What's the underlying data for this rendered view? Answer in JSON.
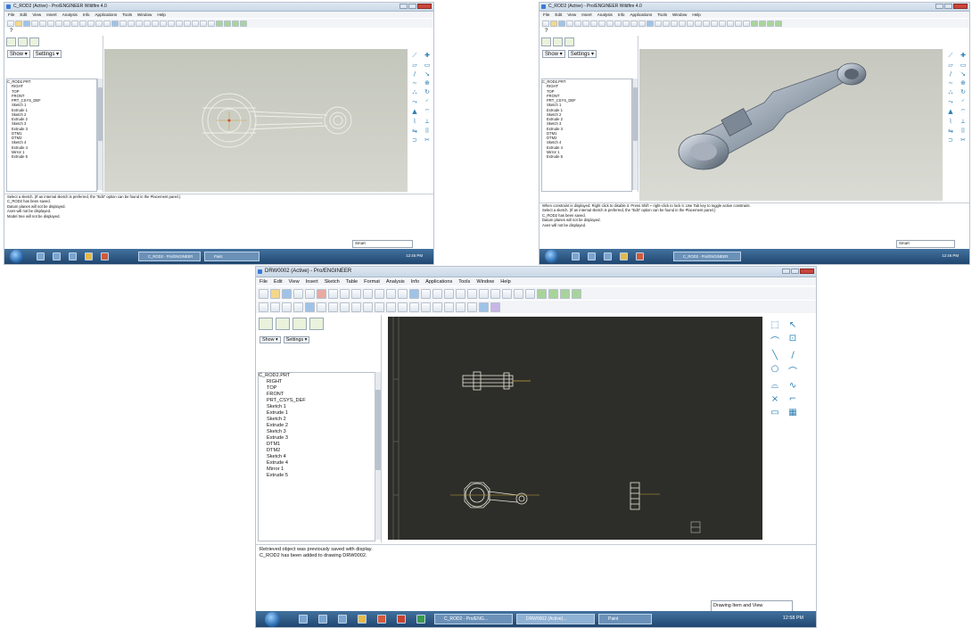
{
  "colors": {
    "viewport_gray": "#c9cbc0",
    "drawing_bg": "#2d2e2a",
    "taskbar": "#2f5a86",
    "accent_icon": "#2a7fb4"
  },
  "screen1": {
    "title": "C_ROD2 (Active) - Pro/ENGINEER Wildfire 4.0",
    "menus": [
      "File",
      "Edit",
      "View",
      "Insert",
      "Analysis",
      "Info",
      "Applications",
      "Tools",
      "Window",
      "Help"
    ],
    "help_icon": "?",
    "show_label": "Show ▾",
    "settings_label": "Settings ▾",
    "tree": [
      "C_ROD2.PRT",
      "RIGHT",
      "TOP",
      "FRONT",
      "PRT_CSYS_DEF",
      "Sketch 1",
      "Extrude 1",
      "Sketch 2",
      "Extrude 2",
      "Sketch 3",
      "Extrude 3",
      "DTM1",
      "DTM2",
      "Sketch 4",
      "Extrude 4",
      "Mirror 1",
      "Extrude 5"
    ],
    "messages": [
      "Select a sketch. (If an internal sketch is preferred, the “Edit” option can be found in the Placement panel.)",
      "C_ROD2 has been saved.",
      "Datum planes will not be displayed.",
      "Axes will not be displayed.",
      "Model tree will not be displayed."
    ],
    "filter": "Smart",
    "taskbar_apps": [
      "C_ROD2 - Pro/ENGINEER",
      "Paint"
    ],
    "clock": "12:45 PM"
  },
  "screen2": {
    "title": "C_ROD2 (Active) - Pro/ENGINEER Wildfire 4.0",
    "menus": [
      "File",
      "Edit",
      "View",
      "Insert",
      "Analysis",
      "Info",
      "Applications",
      "Tools",
      "Window",
      "Help"
    ],
    "help_icon": "?",
    "show_label": "Show ▾",
    "settings_label": "Settings ▾",
    "tree": [
      "C_ROD2.PRT",
      "RIGHT",
      "TOP",
      "FRONT",
      "PRT_CSYS_DEF",
      "Sketch 1",
      "Extrude 1",
      "Sketch 2",
      "Extrude 2",
      "Sketch 3",
      "Extrude 3",
      "DTM1",
      "DTM2",
      "Sketch 4",
      "Extrude 4",
      "Mirror 1",
      "Extrude 5"
    ],
    "messages": [
      "When constraint is displayed: Right click to disable it. Press Shift + right-click to lock it. Use Tab key to toggle active constraint.",
      "Select a sketch. (If an internal sketch is preferred, the “Edit” option can be found in the Placement panel.)",
      "C_ROD2 has been saved.",
      "Datum planes will not be displayed.",
      "Axes will not be displayed."
    ],
    "filter": "Smart",
    "taskbar_apps": [
      "C_ROD2 - Pro/ENGINEER"
    ],
    "clock": "12:46 PM"
  },
  "screen3": {
    "title": "DRW0002 (Active) - Pro/ENGINEER",
    "menus": [
      "File",
      "Edit",
      "View",
      "Insert",
      "Sketch",
      "Table",
      "Format",
      "Analysis",
      "Info",
      "Applications",
      "Tools",
      "Window",
      "Help"
    ],
    "show_label": "Show ▾",
    "settings_label": "Settings ▾",
    "tree": [
      "C_ROD2.PRT",
      "RIGHT",
      "TOP",
      "FRONT",
      "PRT_CSYS_DEF",
      "Sketch 1",
      "Extrude 1",
      "Sketch 2",
      "Extrude 2",
      "Sketch 3",
      "Extrude 3",
      "DTM1",
      "DTM2",
      "Sketch 4",
      "Extrude 4",
      "Mirror 1",
      "Extrude 5"
    ],
    "messages": [
      "Retrieved object was previously saved with display.",
      "C_ROD2 has been added to drawing DRW0002."
    ],
    "filter": "Drawing Item and View",
    "taskbar_apps": [
      "C_ROD2 - Pro/ENG...",
      "DRW0002 (Active)...",
      "Paint"
    ],
    "clock": "12:58 PM",
    "sketch_tools": [
      "⬚",
      "↖",
      "⌒",
      "⊡",
      "╲",
      "∕",
      "○",
      "⌒",
      "⌓",
      "∿",
      "×",
      "⌐",
      "▭",
      "▦"
    ]
  }
}
